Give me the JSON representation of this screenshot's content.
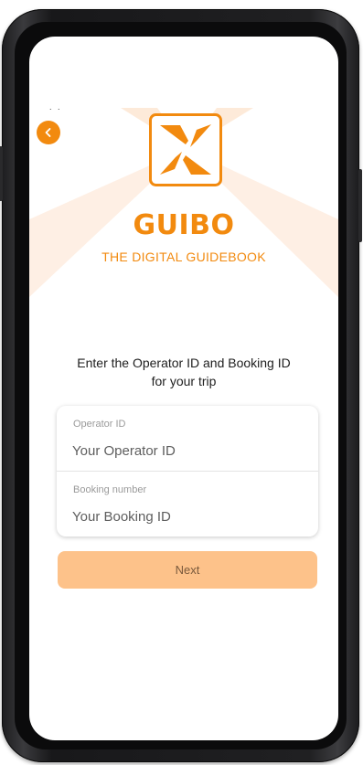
{
  "status_bar": {
    "text": ". ."
  },
  "nav": {
    "back_icon": "chevron-left-icon"
  },
  "brand": {
    "logo_icon": "guibo-x-logo-icon",
    "name": "GUIBO",
    "tagline": "THE DIGITAL GUIDEBOOK",
    "accent_color": "#f28a0f"
  },
  "form": {
    "instruction_line1": "Enter the Operator ID and Booking ID",
    "instruction_line2": "for your trip",
    "operator_id": {
      "label": "Operator ID",
      "placeholder": "Your Operator ID",
      "value": ""
    },
    "booking": {
      "label": "Booking number",
      "placeholder": "Your Booking ID",
      "value": ""
    },
    "next_label": "Next",
    "next_button_color": "#fdc28a"
  }
}
